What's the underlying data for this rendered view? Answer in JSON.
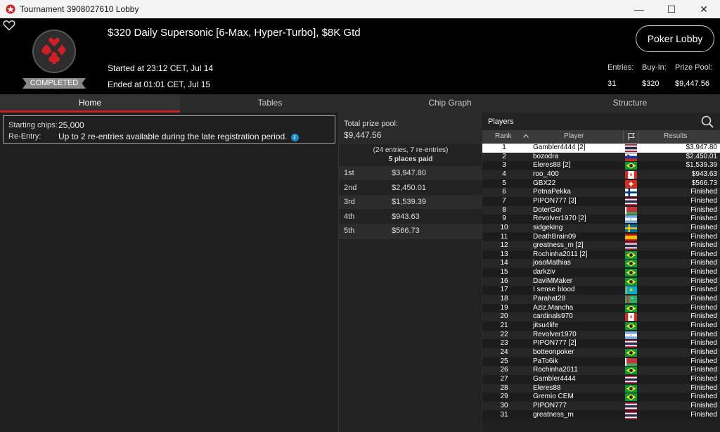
{
  "window": {
    "title": "Tournament 3908027610 Lobby",
    "minimize": "—",
    "maximize": "☐",
    "close": "✕"
  },
  "header": {
    "tournament_name": "$320 Daily Supersonic [6-Max, Hyper-Turbo], $8K Gtd",
    "status": "COMPLETED",
    "started": "Started at 23:12 CET, Jul 14",
    "ended": "Ended at 01:01 CET, Jul 15",
    "poker_lobby_button": "Poker Lobby",
    "entries_label": "Entries:",
    "entries_value": "31",
    "buyin_label": "Buy-In:",
    "buyin_value": "$320",
    "prizepool_label": "Prize Pool:",
    "prizepool_value": "$9,447.56"
  },
  "tabs": [
    "Home",
    "Tables",
    "Chip Graph",
    "Structure"
  ],
  "info": {
    "starting_chips_label": "Starting chips:",
    "starting_chips_value": "25,000",
    "reentry_label": "Re-Entry:",
    "reentry_value": "Up to 2 re-entries available during the late registration period.",
    "info_icon": "i"
  },
  "prize": {
    "pool_label": "Total prize pool:",
    "pool_value": "$9,447.56",
    "entries_line": "(24 entries, 7 re-entries)",
    "paid_line": "5 places paid",
    "places": [
      {
        "place": "1st",
        "amount": "$3,947.80"
      },
      {
        "place": "2nd",
        "amount": "$2,450.01"
      },
      {
        "place": "3rd",
        "amount": "$1,539.39"
      },
      {
        "place": "4th",
        "amount": "$943.63"
      },
      {
        "place": "5th",
        "amount": "$566.73"
      }
    ]
  },
  "players": {
    "title": "Players",
    "col_rank": "Rank",
    "col_player": "Player",
    "col_results": "Results",
    "rows": [
      {
        "rank": "1",
        "name": "Gambler4444 [2]",
        "flag": "thailand",
        "result": "$3,947.80"
      },
      {
        "rank": "2",
        "name": "bozodra",
        "flag": "slovenia",
        "result": "$2,450.01"
      },
      {
        "rank": "3",
        "name": "Eleres88 [2]",
        "flag": "brazil",
        "result": "$1,539.39"
      },
      {
        "rank": "4",
        "name": "roo_400",
        "flag": "canada",
        "result": "$943.63"
      },
      {
        "rank": "5",
        "name": "GBX22",
        "flag": "switzerland",
        "result": "$566.73"
      },
      {
        "rank": "6",
        "name": "PotnaPekka",
        "flag": "finland",
        "result": "Finished"
      },
      {
        "rank": "7",
        "name": "PIPON777 [3]",
        "flag": "thailand",
        "result": "Finished"
      },
      {
        "rank": "8",
        "name": "DoterGor",
        "flag": "belarus",
        "result": "Finished"
      },
      {
        "rank": "9",
        "name": "Revolver1970 [2]",
        "flag": "argentina",
        "result": "Finished"
      },
      {
        "rank": "10",
        "name": "sidgeking",
        "flag": "sweden",
        "result": "Finished"
      },
      {
        "rank": "11",
        "name": "DeathBrain09",
        "flag": "spain",
        "result": "Finished"
      },
      {
        "rank": "12",
        "name": "greatness_m [2]",
        "flag": "thailand",
        "result": "Finished"
      },
      {
        "rank": "13",
        "name": "Rochinha2011 [2]",
        "flag": "brazil",
        "result": "Finished"
      },
      {
        "rank": "14",
        "name": "joaoMathias",
        "flag": "brazil",
        "result": "Finished"
      },
      {
        "rank": "15",
        "name": "darkziv",
        "flag": "brazil",
        "result": "Finished"
      },
      {
        "rank": "16",
        "name": "DaviMMaker",
        "flag": "brazil",
        "result": "Finished"
      },
      {
        "rank": "17",
        "name": "I sense blood",
        "flag": "kazakhstan",
        "result": "Finished"
      },
      {
        "rank": "18",
        "name": "Parahat28",
        "flag": "turkmenistan",
        "result": "Finished"
      },
      {
        "rank": "19",
        "name": "Aziz.Mancha",
        "flag": "brazil",
        "result": "Finished"
      },
      {
        "rank": "20",
        "name": "cardinals970",
        "flag": "canada",
        "result": "Finished"
      },
      {
        "rank": "21",
        "name": "jitsu4life",
        "flag": "brazil",
        "result": "Finished"
      },
      {
        "rank": "22",
        "name": "Revolver1970",
        "flag": "argentina",
        "result": "Finished"
      },
      {
        "rank": "23",
        "name": "PIPON777 [2]",
        "flag": "thailand",
        "result": "Finished"
      },
      {
        "rank": "24",
        "name": "botteonpoker",
        "flag": "brazil",
        "result": "Finished"
      },
      {
        "rank": "25",
        "name": "PaTo6ik",
        "flag": "belarus",
        "result": "Finished"
      },
      {
        "rank": "26",
        "name": "Rochinha2011",
        "flag": "brazil",
        "result": "Finished"
      },
      {
        "rank": "27",
        "name": "Gambler4444",
        "flag": "thailand",
        "result": "Finished"
      },
      {
        "rank": "28",
        "name": "Eleres88",
        "flag": "brazil",
        "result": "Finished"
      },
      {
        "rank": "29",
        "name": "Gremio CEM",
        "flag": "brazil",
        "result": "Finished"
      },
      {
        "rank": "30",
        "name": "PIPON777",
        "flag": "thailand",
        "result": "Finished"
      },
      {
        "rank": "31",
        "name": "greatness_m",
        "flag": "thailand",
        "result": "Finished"
      }
    ]
  },
  "colors": {
    "accent_red": "#c42029",
    "info_blue": "#1a8fcf"
  }
}
